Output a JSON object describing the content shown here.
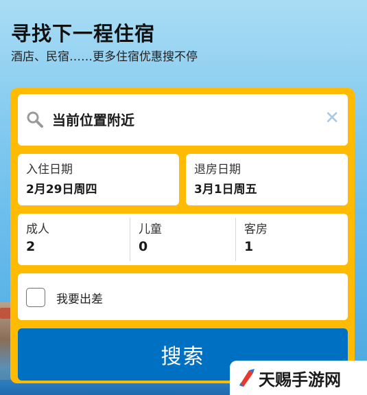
{
  "hero": {
    "title": "寻找下一程住宿",
    "subtitle": "酒店、民宿……更多住宿优惠搜不停"
  },
  "search": {
    "location_value": "当前位置附近",
    "search_icon": "search-icon",
    "clear_icon": "close-icon"
  },
  "dates": {
    "checkin_label": "入住日期",
    "checkin_value": "2月29日周四",
    "checkout_label": "退房日期",
    "checkout_value": "3月1日周五"
  },
  "guests": {
    "adults_label": "成人",
    "adults_value": "2",
    "children_label": "儿童",
    "children_value": "0",
    "rooms_label": "客房",
    "rooms_value": "1"
  },
  "business": {
    "label": "我要出差",
    "checked": false
  },
  "actions": {
    "search_label": "搜索"
  },
  "watermark": {
    "text": "天赐手游网"
  },
  "colors": {
    "panel": "#febb02",
    "primary": "#0071c2",
    "clear_icon": "#a9c7e6"
  }
}
